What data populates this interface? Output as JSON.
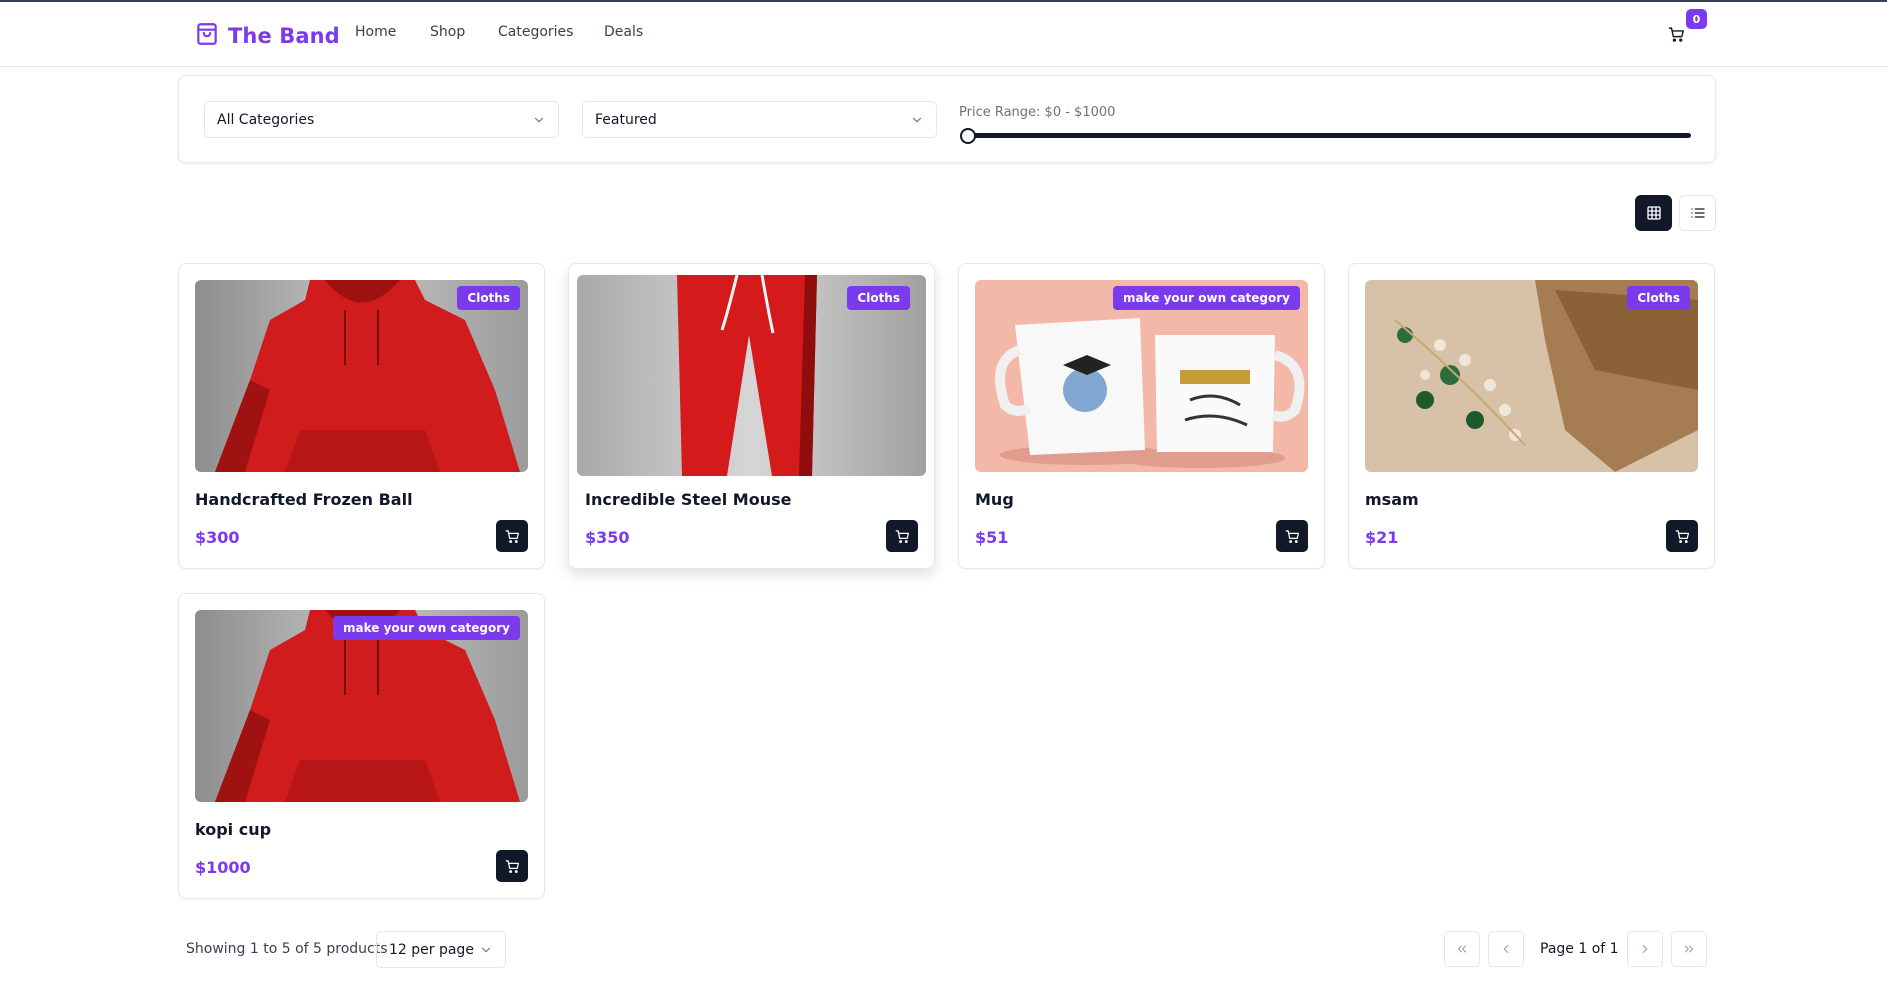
{
  "header": {
    "brand": "The Band",
    "nav": [
      "Home",
      "Shop",
      "Categories",
      "Deals"
    ],
    "cart_count": "0"
  },
  "filters": {
    "category": "All Categories",
    "sort": "Featured",
    "price_range_label": "Price Range: $0 - $1000",
    "price_min": 0,
    "price_max": 1000
  },
  "view": {
    "active": "grid"
  },
  "products": [
    {
      "name": "Handcrafted Frozen Ball",
      "price": "$300",
      "category": "Cloths",
      "image": "red-hoodie"
    },
    {
      "name": "Incredible Steel Mouse",
      "price": "$350",
      "category": "Cloths",
      "image": "red-sweatpants"
    },
    {
      "name": "Mug",
      "price": "$51",
      "category": "make your own category",
      "image": "graduation-mugs"
    },
    {
      "name": "msam",
      "price": "$21",
      "category": "Cloths",
      "image": "jewelry-brooch"
    },
    {
      "name": "kopi cup",
      "price": "$1000",
      "category": "make your own category",
      "image": "red-hoodie"
    }
  ],
  "footer": {
    "showing": "Showing 1 to 5 of 5 products",
    "per_page": "12 per page",
    "page_info": "Page 1 of 1"
  },
  "colors": {
    "accent": "#7c3aed",
    "dark": "#111827",
    "border": "#e5e7eb"
  }
}
